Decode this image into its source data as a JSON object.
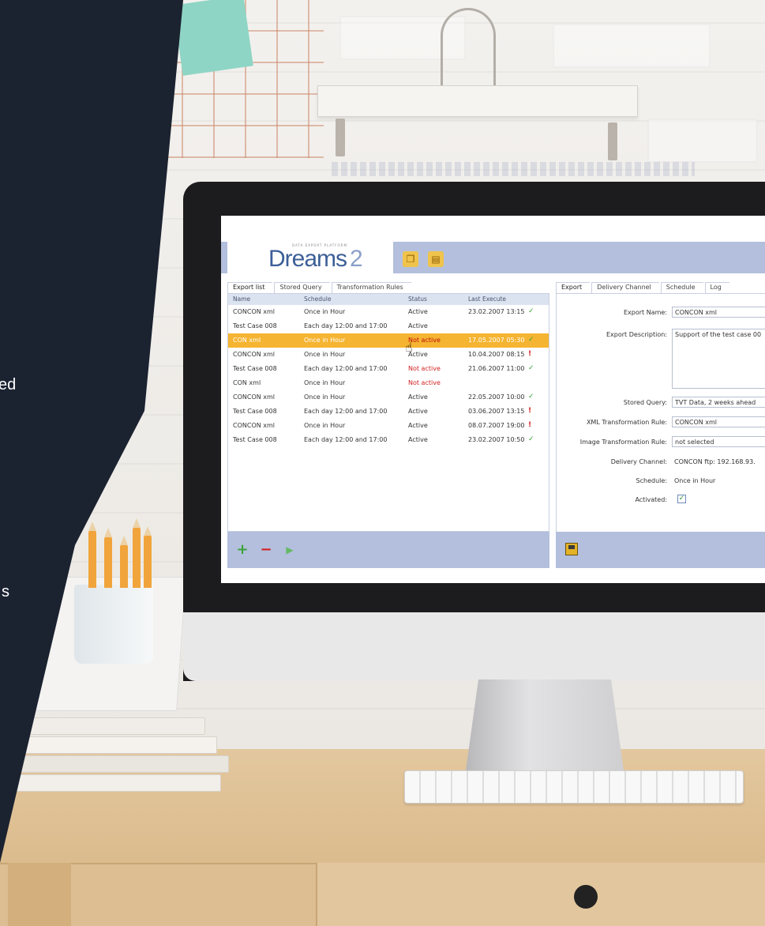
{
  "panel": {
    "fragments": [
      "ed",
      "s"
    ]
  },
  "app": {
    "logo_tag": "DATA EXPORT PLATFORM",
    "logo_name": "Dreams",
    "logo_version": "2",
    "header_icons": [
      "book-icon",
      "document-icon"
    ]
  },
  "list_tabs": [
    "Export list",
    "Stored Query",
    "Transformation Rules"
  ],
  "list": {
    "columns": [
      "Name",
      "Schedule",
      "Status",
      "Last Execute"
    ],
    "rows": [
      {
        "name": "CONCON xml",
        "schedule": "Once in Hour",
        "status": "Active",
        "last": "23.02.2007 13:15",
        "mark": "✓"
      },
      {
        "name": "Test Case 008",
        "schedule": "Each day 12:00 and 17:00",
        "status": "Active",
        "last": "",
        "mark": ""
      },
      {
        "name": "CON xml",
        "schedule": "Once in Hour",
        "status": "Not active",
        "last": "17.05.2007 05:30",
        "mark": "✓"
      },
      {
        "name": "CONCON xml",
        "schedule": "Once in Hour",
        "status": "Active",
        "last": "10.04.2007 08:15",
        "mark": "!"
      },
      {
        "name": "Test Case 008",
        "schedule": "Each day 12:00 and 17:00",
        "status": "Not active",
        "last": "21.06.2007 11:00",
        "mark": "✓"
      },
      {
        "name": "CON xml",
        "schedule": "Once in Hour",
        "status": "Not active",
        "last": "",
        "mark": ""
      },
      {
        "name": "CONCON xml",
        "schedule": "Once in Hour",
        "status": "Active",
        "last": "22.05.2007 10:00",
        "mark": "✓"
      },
      {
        "name": "Test Case 008",
        "schedule": "Each day 12:00 and 17:00",
        "status": "Active",
        "last": "03.06.2007 13:15",
        "mark": "!"
      },
      {
        "name": "CONCON xml",
        "schedule": "Once in Hour",
        "status": "Active",
        "last": "08.07.2007 19:00",
        "mark": "!"
      },
      {
        "name": "Test Case 008",
        "schedule": "Each day 12:00 and 17:00",
        "status": "Active",
        "last": "23.02.2007 10:50",
        "mark": "✓"
      }
    ]
  },
  "list_toolbar": {
    "add": "+",
    "remove": "−",
    "run": "▶"
  },
  "detail_tabs": [
    "Export",
    "Delivery Channel",
    "Schedule",
    "Log"
  ],
  "detail": {
    "export_name_label": "Export Name:",
    "export_name": "CONCON xml",
    "export_desc_label": "Export Description:",
    "export_desc": "Support of the test case 00",
    "stored_query_label": "Stored Query:",
    "stored_query": "TVT Data, 2 weeks ahead",
    "xml_rule_label": "XML Transformation Rule:",
    "xml_rule": "CONCON xml",
    "image_rule_label": "Image Transformation Rule:",
    "image_rule": "not selected",
    "delivery_label": "Delivery Channel:",
    "delivery": "CONCON ftp: 192.168.93.",
    "schedule_label": "Schedule:",
    "schedule": "Once in Hour",
    "activated_label": "Activated:",
    "activated": "✓"
  },
  "colors": {
    "accent": "#b3bfdc",
    "selected_row": "#f5b431",
    "error_red": "#d21f1f",
    "ok_green": "#3aa33a",
    "dark_panel": "#1b2230"
  }
}
